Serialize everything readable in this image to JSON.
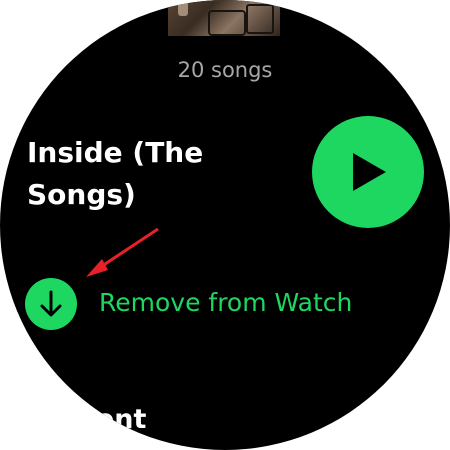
{
  "playlist": {
    "song_count": "20 songs",
    "title": "Inside (The Songs)"
  },
  "actions": {
    "play_icon": "play-icon",
    "remove_label": "Remove from Watch",
    "remove_icon": "download-arrow-icon"
  },
  "next_section": {
    "label": "ent"
  },
  "colors": {
    "accent": "#1ed760",
    "background": "#000000",
    "secondary_text": "#a7a7a7",
    "annotation_arrow": "#e8202a"
  }
}
